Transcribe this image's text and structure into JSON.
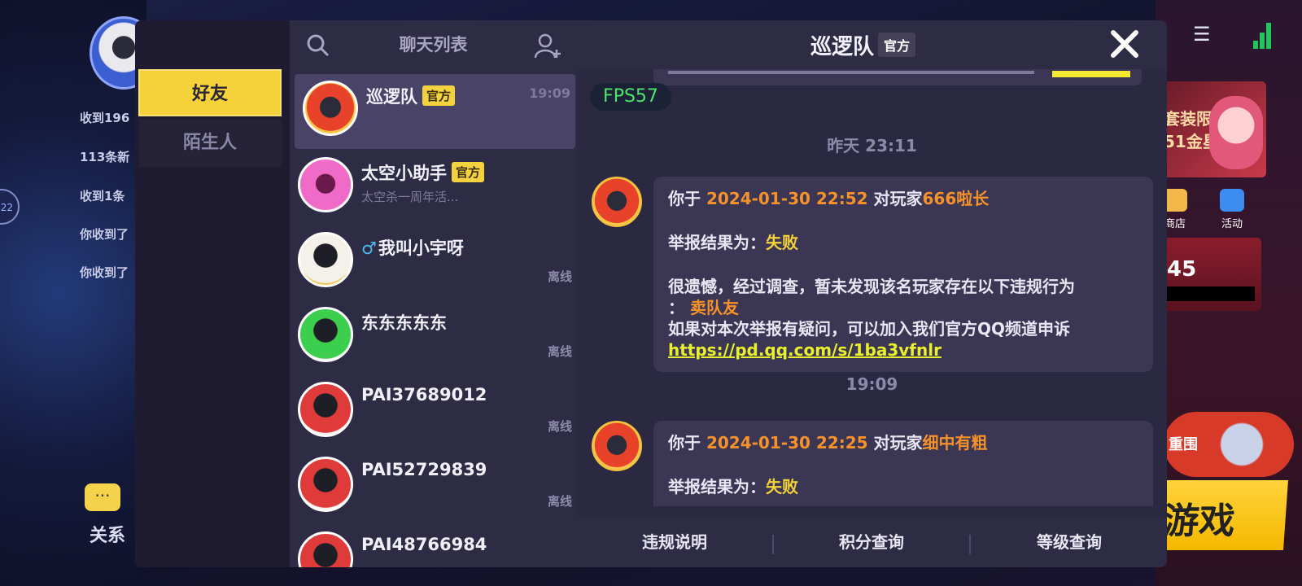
{
  "background": {
    "notices": [
      "收到196",
      "113条新",
      "收到1条",
      "你收到了",
      "你收到了"
    ],
    "relation_label": "关系",
    "banner_texts": [
      "套装限低",
      "51金星"
    ],
    "shop_label": "商店",
    "activity_label": "活动",
    "promo_number": "45",
    "mount_text": "重围",
    "game_label": "游戏",
    "bubble_text": "22"
  },
  "sidebar": {
    "tabs": [
      {
        "label": "好友",
        "active": true
      },
      {
        "label": "陌生人",
        "active": false
      }
    ]
  },
  "chat_list": {
    "title": "聊天列表",
    "items": [
      {
        "name": "巡逻队",
        "badge": "官方",
        "time": "19:09",
        "selected": true
      },
      {
        "name": "太空小助手",
        "badge": "官方",
        "preview": "太空杀一周年活..."
      },
      {
        "gender": "♂",
        "name": "我叫小宇呀",
        "status": "离线"
      },
      {
        "name": "东东东东东",
        "status": "离线"
      },
      {
        "name": "PAI37689012",
        "status": "离线"
      },
      {
        "name": "PAI52729839",
        "status": "离线"
      },
      {
        "name": "PAI48766984"
      }
    ]
  },
  "chat": {
    "title": "巡逻队",
    "badge": "官方",
    "fps": "FPS57",
    "timestamps": [
      "昨天 23:11",
      "19:09"
    ],
    "messages": [
      {
        "prefix": "你于",
        "datetime": "2024-01-30 22:52",
        "player_prefix": "对玩家",
        "player": "666啦长",
        "result_label": "举报结果为：",
        "result": "失败",
        "reason_line": "很遗憾，经过调查，暂未发现该名玩家存在以下违规行为",
        "reason_colon": "：",
        "violation": "卖队友",
        "appeal_line": "如果对本次举报有疑问，可以加入我们官方QQ频道申诉",
        "link": "https://pd.qq.com/s/1ba3vfnlr"
      },
      {
        "prefix": "你于",
        "datetime": "2024-01-30 22:25",
        "player_prefix": "对玩家",
        "player": "细中有粗",
        "result_label": "举报结果为：",
        "result": "失败"
      }
    ],
    "footer": [
      "违规说明",
      "积分查询",
      "等级查询"
    ]
  },
  "colors": {
    "accent_yellow": "#f5d23a",
    "highlight_orange": "#f7922a",
    "fps_green": "#4ee36d",
    "panel_bg": "#2b2841"
  }
}
